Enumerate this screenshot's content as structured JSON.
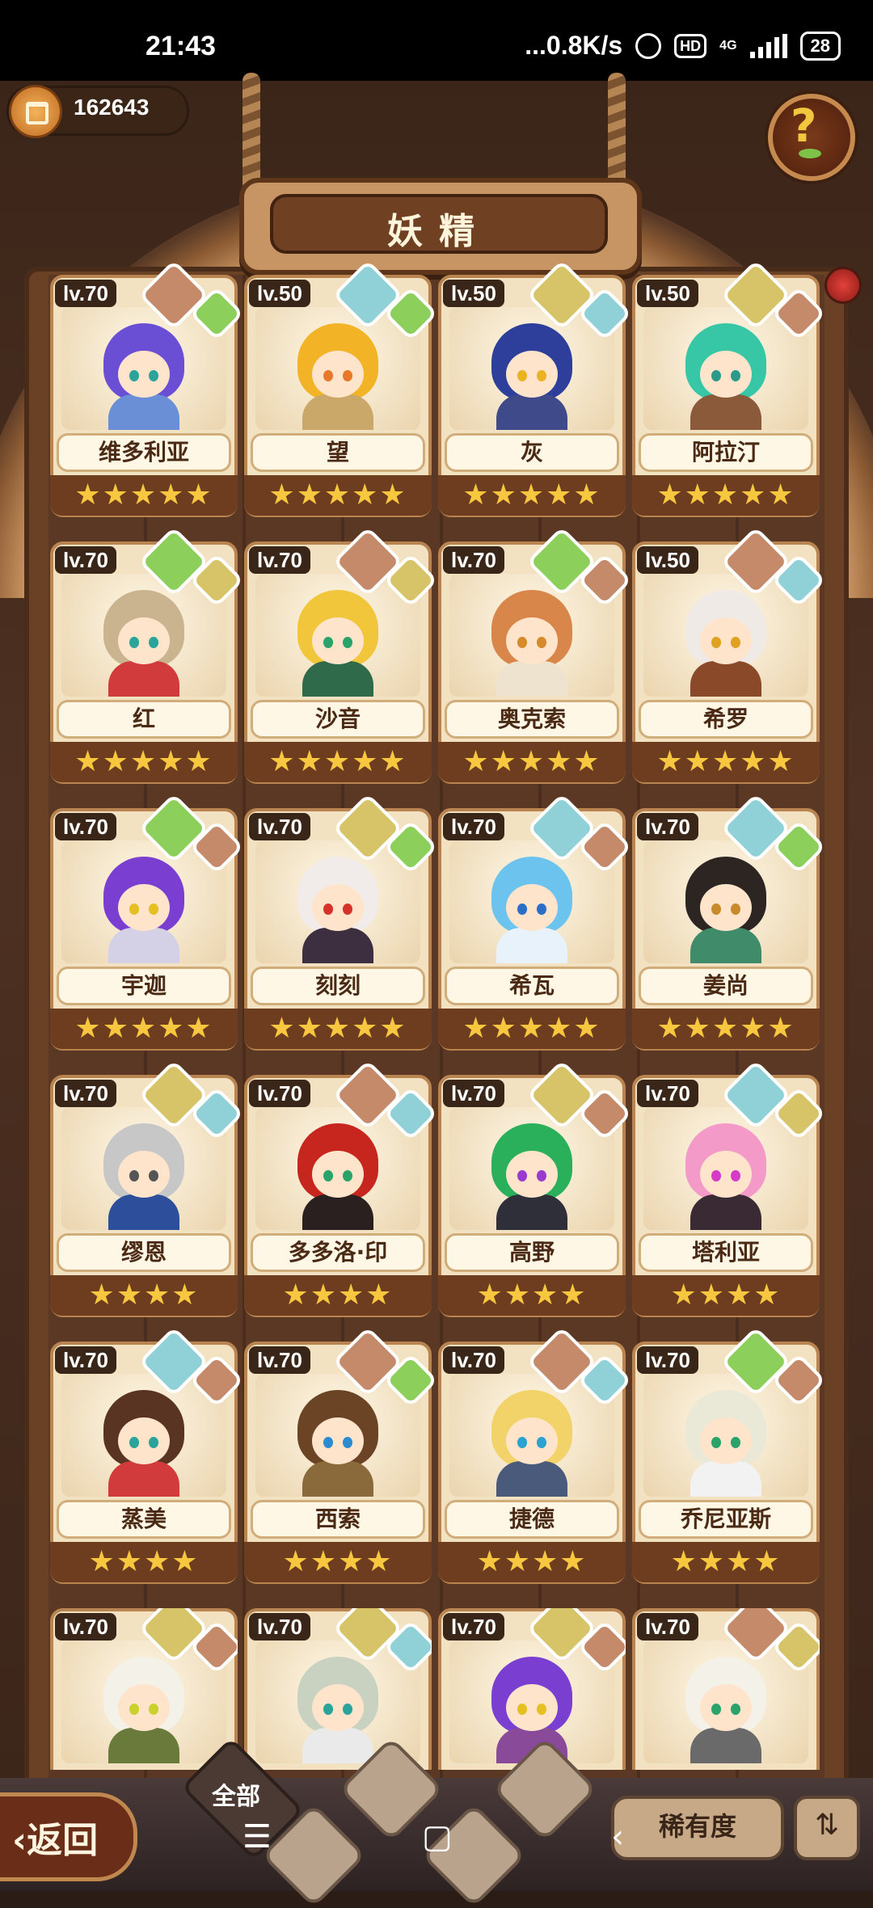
{
  "status_bar": {
    "time": "21:43",
    "network": "...0.8K/s",
    "hd": "HD",
    "net_type": "4G",
    "battery": "28"
  },
  "header": {
    "coins": "162643",
    "title": "妖精",
    "help_label": "?"
  },
  "cards": [
    {
      "level": "lv.70",
      "name": "维多利亚",
      "stars": "★★★★★",
      "hair": "#6a4fd4",
      "body": "#6b8fd6",
      "eye": "#2aa39b",
      "elem1": "#c48a6a",
      "elem2": "#8ccf5a"
    },
    {
      "level": "lv.50",
      "name": "望",
      "stars": "★★★★★",
      "hair": "#f2b326",
      "body": "#c9a86a",
      "eye": "#e7782a",
      "elem1": "#8fd1d6",
      "elem2": "#8ccf5a"
    },
    {
      "level": "lv.50",
      "name": "灰",
      "stars": "★★★★★",
      "hair": "#2d3f9a",
      "body": "#3f4a8a",
      "eye": "#e9b321",
      "elem1": "#d7c468",
      "elem2": "#8fd1d6"
    },
    {
      "level": "lv.50",
      "name": "阿拉汀",
      "stars": "★★★★★",
      "hair": "#37c7a6",
      "body": "#8b5a3a",
      "eye": "#2a9b8a",
      "elem1": "#d7c468",
      "elem2": "#c48a6a"
    },
    {
      "level": "lv.70",
      "name": "红",
      "stars": "★★★★★",
      "hair": "#c9b48f",
      "body": "#d23b3b",
      "eye": "#2aa39b",
      "elem1": "#8ccf5a",
      "elem2": "#d7c468"
    },
    {
      "level": "lv.70",
      "name": "沙音",
      "stars": "★★★★★",
      "hair": "#f2c63a",
      "body": "#2f6b4a",
      "eye": "#2aa36b",
      "elem1": "#c48a6a",
      "elem2": "#d7c468"
    },
    {
      "level": "lv.70",
      "name": "奥克索",
      "stars": "★★★★★",
      "hair": "#d9864a",
      "body": "#ede3cf",
      "eye": "#d68a2a",
      "elem1": "#8ccf5a",
      "elem2": "#c48a6a"
    },
    {
      "level": "lv.50",
      "name": "希罗",
      "stars": "★★★★★",
      "hair": "#efeae6",
      "body": "#8a4a2a",
      "eye": "#e0a021",
      "elem1": "#c48a6a",
      "elem2": "#8fd1d6"
    },
    {
      "level": "lv.70",
      "name": "宇迦",
      "stars": "★★★★★",
      "hair": "#7a3ed1",
      "body": "#d4d0e6",
      "eye": "#e6c021",
      "elem1": "#8ccf5a",
      "elem2": "#c48a6a"
    },
    {
      "level": "lv.70",
      "name": "刻刻",
      "stars": "★★★★★",
      "hair": "#f1ece9",
      "body": "#3d2f3f",
      "eye": "#d6322a",
      "elem1": "#d7c468",
      "elem2": "#8ccf5a"
    },
    {
      "level": "lv.70",
      "name": "希瓦",
      "stars": "★★★★★",
      "hair": "#6cc3ee",
      "body": "#e8f2fa",
      "eye": "#2a6ec9",
      "elem1": "#8fd1d6",
      "elem2": "#c48a6a"
    },
    {
      "level": "lv.70",
      "name": "姜尚",
      "stars": "★★★★★",
      "hair": "#2c2522",
      "body": "#3f8b6a",
      "eye": "#c98a2a",
      "elem1": "#8fd1d6",
      "elem2": "#8ccf5a"
    },
    {
      "level": "lv.70",
      "name": "缪恩",
      "stars": "★★★★",
      "hair": "#c7c7c7",
      "body": "#2d4e9a",
      "eye": "#555555",
      "elem1": "#d7c468",
      "elem2": "#8fd1d6"
    },
    {
      "level": "lv.70",
      "name": "多多洛·印",
      "stars": "★★★★",
      "hair": "#c7261f",
      "body": "#2b2020",
      "eye": "#2aa36b",
      "elem1": "#c48a6a",
      "elem2": "#8fd1d6"
    },
    {
      "level": "lv.70",
      "name": "高野",
      "stars": "★★★★",
      "hair": "#2ab05a",
      "body": "#2f2f3a",
      "eye": "#9a3ad1",
      "elem1": "#d7c468",
      "elem2": "#c48a6a"
    },
    {
      "level": "lv.70",
      "name": "塔利亚",
      "stars": "★★★★",
      "hair": "#f39ac9",
      "body": "#3a2a34",
      "eye": "#d63ac9",
      "elem1": "#8fd1d6",
      "elem2": "#d7c468"
    },
    {
      "level": "lv.70",
      "name": "蒸美",
      "stars": "★★★★",
      "hair": "#5a3422",
      "body": "#d23b3b",
      "eye": "#2aa39b",
      "elem1": "#8fd1d6",
      "elem2": "#c48a6a"
    },
    {
      "level": "lv.70",
      "name": "西索",
      "stars": "★★★★",
      "hair": "#6b4426",
      "body": "#8a6a3a",
      "eye": "#2a8bd1",
      "elem1": "#c48a6a",
      "elem2": "#8ccf5a"
    },
    {
      "level": "lv.70",
      "name": "捷德",
      "stars": "★★★★",
      "hair": "#f2d36a",
      "body": "#4a5a7a",
      "eye": "#2aa3d1",
      "elem1": "#c48a6a",
      "elem2": "#8fd1d6"
    },
    {
      "level": "lv.70",
      "name": "乔尼亚斯",
      "stars": "★★★★",
      "hair": "#eae8d6",
      "body": "#f2f2f2",
      "eye": "#2aa36b",
      "elem1": "#8ccf5a",
      "elem2": "#c48a6a"
    },
    {
      "level": "lv.70",
      "name": "",
      "stars": "",
      "hair": "#f4f1e8",
      "body": "#6a7a3a",
      "eye": "#c9d12a",
      "elem1": "#d7c468",
      "elem2": "#c48a6a"
    },
    {
      "level": "lv.70",
      "name": "",
      "stars": "",
      "hair": "#c9d1c0",
      "body": "#eaeaea",
      "eye": "#2aa39b",
      "elem1": "#d7c468",
      "elem2": "#8fd1d6"
    },
    {
      "level": "lv.70",
      "name": "",
      "stars": "",
      "hair": "#7a3ed1",
      "body": "#8a4a9a",
      "eye": "#e6c021",
      "elem1": "#d7c468",
      "elem2": "#c48a6a"
    },
    {
      "level": "lv.70",
      "name": "",
      "stars": "",
      "hair": "#f4f1e8",
      "body": "#6a6a6a",
      "eye": "#2aa36b",
      "elem1": "#c48a6a",
      "elem2": "#d7c468"
    }
  ],
  "bottom_bar": {
    "back_label": "‹返回",
    "filter_all": "全部",
    "rarity_label": "稀有度",
    "sort_icon": "⇅"
  },
  "nav": {
    "menu": "☰",
    "home": "▢",
    "back": "‹"
  }
}
